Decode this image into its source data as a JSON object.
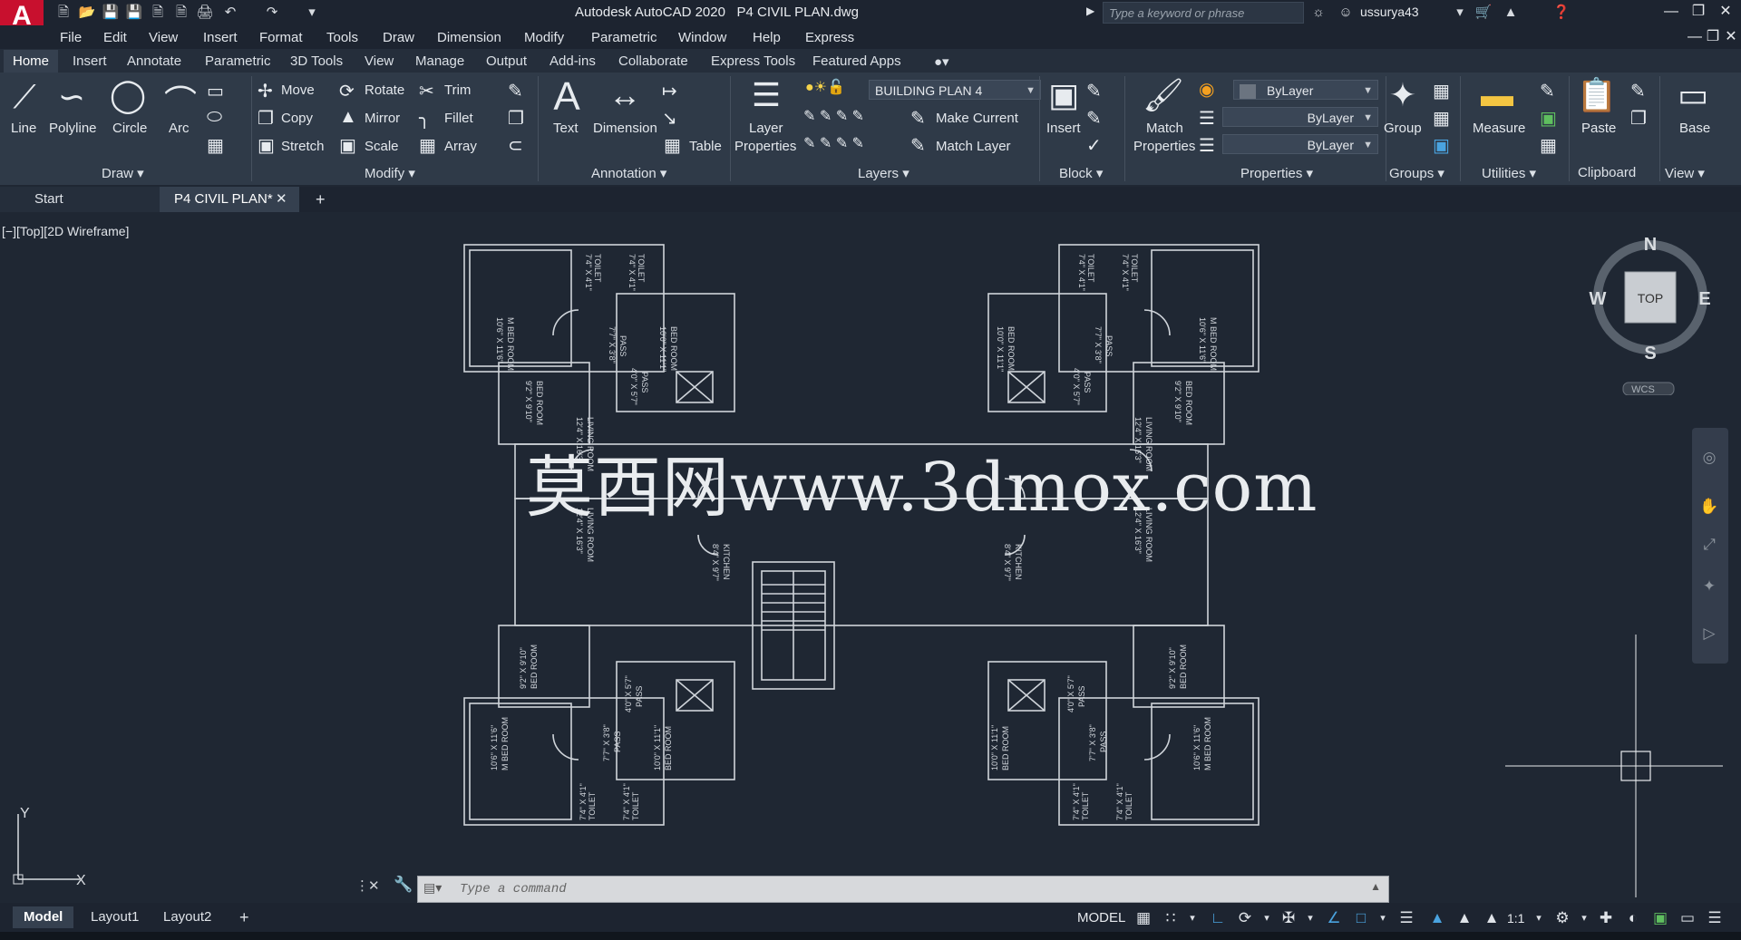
{
  "app": {
    "logo": "A",
    "title": "Autodesk AutoCAD 2020",
    "file": "P4 CIVIL PLAN.dwg",
    "search_placeholder": "Type a keyword or phrase",
    "user": "ussurya43"
  },
  "menu": [
    "File",
    "Edit",
    "View",
    "Insert",
    "Format",
    "Tools",
    "Draw",
    "Dimension",
    "Modify",
    "Parametric",
    "Window",
    "Help",
    "Express"
  ],
  "ribbon_tabs": [
    "Home",
    "Insert",
    "Annotate",
    "Parametric",
    "3D Tools",
    "View",
    "Manage",
    "Output",
    "Add-ins",
    "Collaborate",
    "Express Tools",
    "Featured Apps"
  ],
  "draw": {
    "title": "Draw",
    "line": "Line",
    "polyline": "Polyline",
    "circle": "Circle",
    "arc": "Arc"
  },
  "modify": {
    "title": "Modify",
    "move": "Move",
    "rotate": "Rotate",
    "trim": "Trim",
    "copy": "Copy",
    "mirror": "Mirror",
    "fillet": "Fillet",
    "stretch": "Stretch",
    "scale": "Scale",
    "array": "Array"
  },
  "annotation": {
    "title": "Annotation",
    "text": "Text",
    "dimension": "Dimension",
    "table": "Table"
  },
  "layers": {
    "title": "Layers",
    "layer_properties_1": "Layer",
    "layer_properties_2": "Properties",
    "current_layer": "BUILDING PLAN 4",
    "make_current": "Make Current",
    "match_layer": "Match Layer"
  },
  "block": {
    "title": "Block",
    "insert": "Insert"
  },
  "properties": {
    "title": "Properties",
    "match_1": "Match",
    "match_2": "Properties",
    "color": "ByLayer",
    "linetype": "ByLayer",
    "lineweight": "ByLayer"
  },
  "groups": {
    "title": "Groups",
    "group": "Group"
  },
  "utilities": {
    "title": "Utilities",
    "measure": "Measure"
  },
  "clipboard": {
    "title": "Clipboard",
    "paste": "Paste"
  },
  "view_panel": {
    "title": "View",
    "base": "Base"
  },
  "doc_tabs": {
    "start": "Start",
    "active": "P4 CIVIL PLAN*"
  },
  "viewport_label": "[−][Top][2D Wireframe]",
  "viewcube": {
    "n": "N",
    "s": "S",
    "e": "E",
    "w": "W",
    "top": "TOP",
    "wcs": "WCS"
  },
  "ucs": {
    "x": "X",
    "y": "Y"
  },
  "rooms": {
    "toilet": "TOILET",
    "toilet_size": "7'4\" X 4'1\"",
    "mbed": "M BED ROOM",
    "mbed_size": "10'6\" X 11'6\"",
    "bed": "BED ROOM",
    "bed_size": "10'0\" X 11'1\"",
    "bed2_size": "9'2\" X 9'10\"",
    "pass": "PASS",
    "pass_size": "7'7\" X 3'8\"",
    "pass2_size": "4'0\" X 5'7\"",
    "living": "LIVING ROOM",
    "living_size": "12'4\" X 16'3\"",
    "kitchen": "KITCHEN",
    "kitchen_size": "8'4\" X 9'7\""
  },
  "watermark": "莫西网www.3dmox.com",
  "command": {
    "placeholder": "Type a command"
  },
  "layout_tabs": [
    "Model",
    "Layout1",
    "Layout2"
  ],
  "status": {
    "model": "MODEL",
    "scale": "1:1"
  },
  "colors": {
    "accent": "#4aa3df",
    "logo": "#c8102e",
    "background": "#1f2733"
  }
}
